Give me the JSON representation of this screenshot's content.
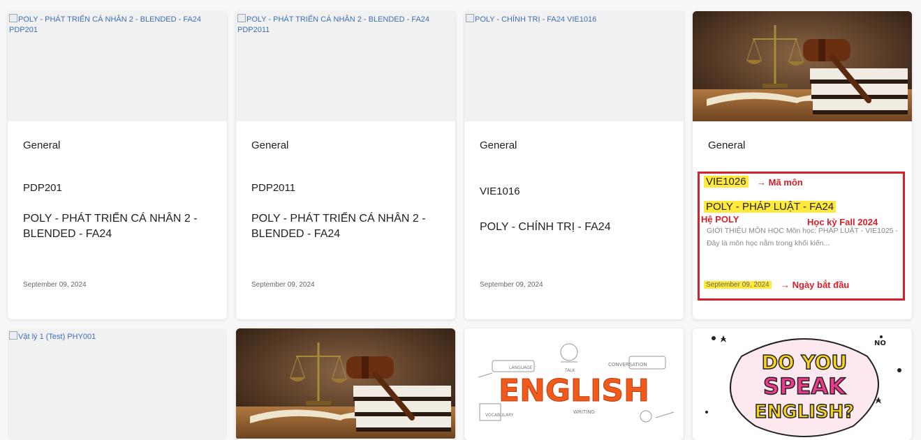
{
  "cards": [
    {
      "image_alt": "POLY - PHÁT TRIỂN CÁ NHÂN 2 - BLENDED - FA24 PDP201",
      "category": "General",
      "code": "PDP201",
      "name": "POLY - PHÁT TRIỂN CÁ NHÂN 2 - BLENDED - FA24",
      "date": "September 09, 2024"
    },
    {
      "image_alt": "POLY - PHÁT TRIỂN CÁ NHÂN 2 - BLENDED - FA24 PDP2011",
      "category": "General",
      "code": "PDP2011",
      "name": "POLY - PHÁT TRIỂN CÁ NHÂN 2 - BLENDED - FA24",
      "date": "September 09, 2024"
    },
    {
      "image_alt": "POLY - CHÍNH TRỊ - FA24 VIE1016",
      "category": "General",
      "code": "VIE1016",
      "name": "POLY - CHÍNH TRỊ - FA24",
      "date": "September 09, 2024"
    },
    {
      "image_icon": "law-scales-gavel-image",
      "category": "General",
      "code": "VIE1026",
      "name": "POLY - PHÁP LUẬT - FA24",
      "description": "GIỚI THIỆU MÔN HỌC Môn học: PHÁP LUẬT - VIE1025 - Đây là môn học nằm trong khối kiến...",
      "date": "September 09, 2024",
      "annotations": {
        "code": "→ Mã môn",
        "system": "Hệ POLY",
        "semester": "Học kỳ Fall 2024",
        "date": "→ Ngày bắt đầu"
      }
    }
  ],
  "bottom_cards": [
    {
      "image_alt": "Vật lý 1 (Test) PHY001"
    },
    {
      "image_icon": "law-scales-gavel-image"
    },
    {
      "image_icon": "english-doodle-image",
      "image_text": "ENGLISH",
      "doodle_words": [
        "LANGUAGE",
        "TALK",
        "CONVERSATION",
        "WRITING",
        "VOCABULARY"
      ]
    },
    {
      "image_icon": "do-you-speak-english-image",
      "image_text": [
        "DO YOU",
        "SPEAK",
        "ENGLISH?"
      ],
      "corner_text": "NO"
    }
  ],
  "colors": {
    "annotation_red": "#d8202a",
    "highlight_yellow": "#ffe93a",
    "link_blue": "#3d6fb5"
  }
}
